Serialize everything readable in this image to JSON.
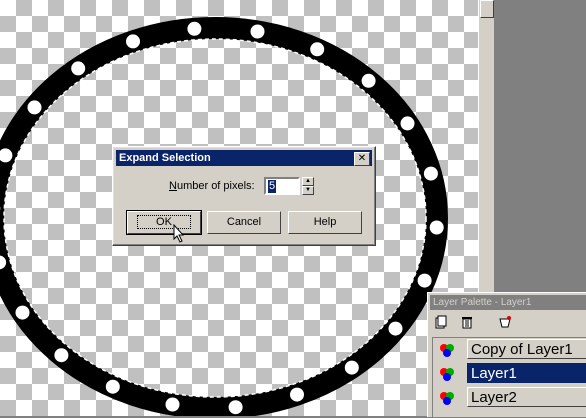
{
  "dialog": {
    "title": "Expand Selection",
    "close_glyph": "✕",
    "field_label_prefix": "N",
    "field_label_rest": "umber of pixels:",
    "pixels_value": "5",
    "ok_label": "OK",
    "cancel_label": "Cancel",
    "help_label": "Help"
  },
  "layer_palette": {
    "title": "Layer Palette - Layer1",
    "layers": [
      {
        "name": "Copy of Layer1",
        "selected": false
      },
      {
        "name": "Layer1",
        "selected": true
      },
      {
        "name": "Layer2",
        "selected": false
      }
    ]
  },
  "colors": {
    "title_bar_active": "#0a246a",
    "title_bar_inactive": "#808080",
    "face": "#d4d0c8"
  },
  "icons": [
    "close-icon",
    "spin-up-icon",
    "spin-down-icon",
    "mouse-cursor-icon",
    "new-layer-icon",
    "delete-layer-icon",
    "mask-icon",
    "layer-visibility-icon"
  ]
}
